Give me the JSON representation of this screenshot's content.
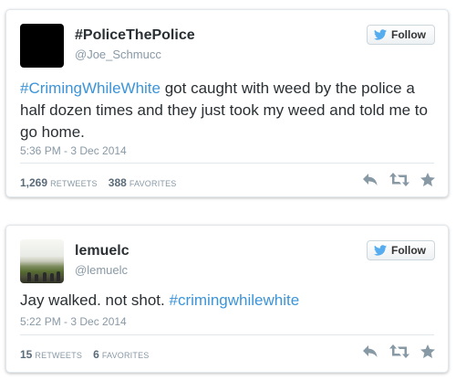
{
  "tweets": [
    {
      "display_name": "#PoliceThePolice",
      "handle": "@Joe_Schmucc",
      "follow_label": "Follow",
      "text_hashtag": "#CrimingWhileWhite",
      "text_rest": " got caught with weed by the police a half dozen times and they just took my weed and told me to go home.",
      "timestamp": "5:36 PM - 3 Dec 2014",
      "retweets": "1,269",
      "retweets_label": "RETWEETS",
      "favorites": "388",
      "favorites_label": "FAVORITES"
    },
    {
      "display_name": "lemuelc",
      "handle": "@lemuelc",
      "follow_label": "Follow",
      "text_before": "Jay walked. not shot. ",
      "text_hashtag": "#crimingwhilewhite",
      "timestamp": "5:22 PM - 3 Dec 2014",
      "retweets": "15",
      "retweets_label": "RETWEETS",
      "favorites": "6",
      "favorites_label": "FAVORITES"
    }
  ],
  "colors": {
    "link": "#3b94d9",
    "meta": "#8899a6",
    "bird": "#55acee",
    "icon": "#8899a6"
  },
  "icons": [
    "twitter-bird-icon",
    "reply-icon",
    "retweet-icon",
    "favorite-star-icon"
  ]
}
